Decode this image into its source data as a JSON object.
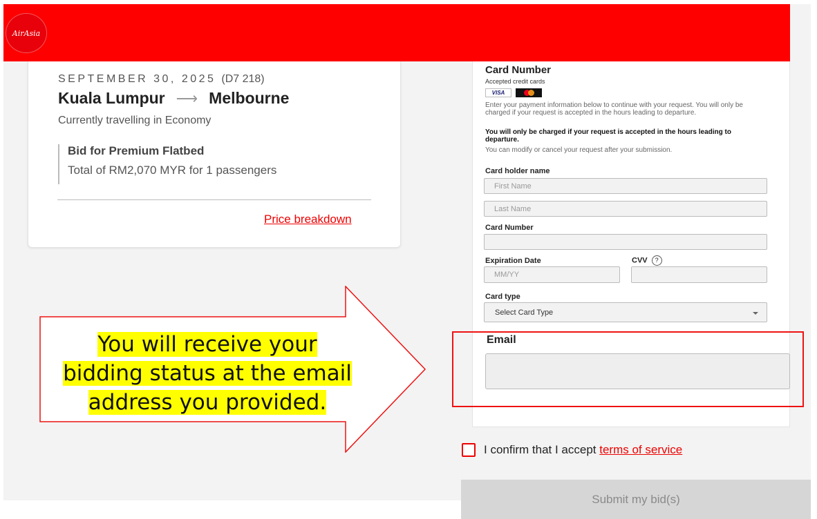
{
  "header": {
    "logo_text": "AirAsia",
    "brand_color": "#ff0000"
  },
  "booking": {
    "date": "SEPTEMBER 30, 2025",
    "flight_code": "(D7 218)",
    "origin": "Kuala Lumpur",
    "arrow": "⟶",
    "destination": "Melbourne",
    "cabin_status": "Currently travelling in Economy",
    "bid_title": "Bid for Premium Flatbed",
    "bid_total": "Total of RM2,070 MYR for 1 passengers",
    "price_breakdown_link": "Price breakdown"
  },
  "payment": {
    "heading": "Card Number",
    "accepted_cards_label": "Accepted credit cards",
    "card_logos": [
      "VISA",
      "mastercard"
    ],
    "info_text": "Enter your payment information below to continue with your request. You will only be charged if your request is accepted in the hours leading to departure.",
    "bold_notice": "You will only be charged if your request is accepted in the hours leading to departure.",
    "modify_text": "You can modify or cancel your request after your submission.",
    "card_holder_label": "Card holder name",
    "first_name_placeholder": "First Name",
    "last_name_placeholder": "Last Name",
    "card_number_label": "Card Number",
    "card_number_value": "",
    "expiration_label": "Expiration Date",
    "expiration_placeholder": "MM/YY",
    "cvv_label": "CVV",
    "cvv_help_icon": "?",
    "cvv_value": "",
    "card_type_label": "Card type",
    "card_type_selected": "Select Card Type",
    "email_label": "Email",
    "email_value": ""
  },
  "confirm": {
    "text": "I confirm that I accept",
    "terms_link": "terms of service",
    "checked": false
  },
  "submit": {
    "label": "Submit my bid(s)"
  },
  "callout": {
    "line1": "You will receive your",
    "line2": "bidding status at the email",
    "line3": "address you provided.",
    "highlight_color": "#ffff00",
    "arrow_color": "#ee1111"
  }
}
